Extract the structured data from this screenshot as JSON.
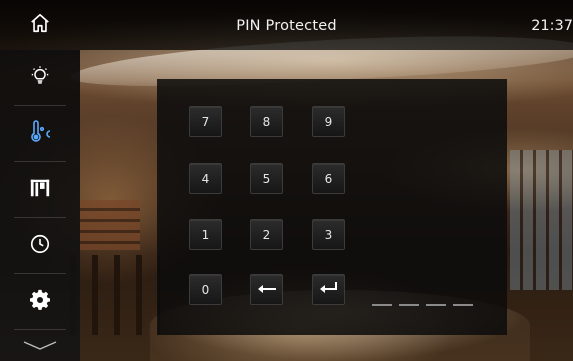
{
  "header": {
    "title": "PIN Protected",
    "time": "21:37"
  },
  "sidebar": {
    "home_icon": "home-icon",
    "items": [
      {
        "name": "lighting",
        "icon": "light-bulb-icon",
        "accent": "#ffffff"
      },
      {
        "name": "climate",
        "icon": "thermometer-celsius-icon",
        "accent": "#5aa9ff"
      },
      {
        "name": "shades",
        "icon": "window-blinds-icon",
        "accent": "#ffffff"
      },
      {
        "name": "scheduler",
        "icon": "clock-icon",
        "accent": "#ffffff"
      },
      {
        "name": "settings",
        "icon": "gear-icon",
        "accent": "#ffffff"
      }
    ],
    "more_icon": "chevron-down-icon"
  },
  "keypad": {
    "keys": [
      "7",
      "8",
      "9",
      "4",
      "5",
      "6",
      "1",
      "2",
      "3",
      "0"
    ],
    "backspace_icon": "backspace-arrow-icon",
    "enter_icon": "enter-return-icon",
    "pin_slots": 4
  }
}
